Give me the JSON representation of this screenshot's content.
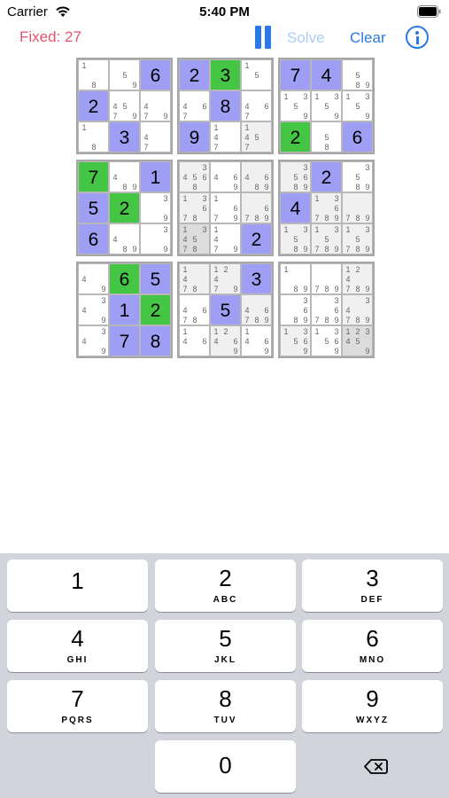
{
  "status_bar": {
    "carrier": "Carrier",
    "time": "5:40 PM"
  },
  "nav": {
    "fixed_label": "Fixed: 27",
    "solve_label": "Solve",
    "clear_label": "Clear"
  },
  "colors": {
    "blue_cell": "#9e9ef5",
    "green_cell": "#44c544",
    "accent": "#2a79e6",
    "fixed_text": "#e8526e"
  },
  "grid": [
    [
      {
        "n": [
          1,
          8
        ]
      },
      {
        "n": [
          5,
          9
        ]
      },
      {
        "v": "6",
        "c": "blue"
      },
      {
        "v": "2",
        "c": "blue"
      },
      {
        "v": "3",
        "c": "green"
      },
      {
        "n": [
          1,
          5
        ]
      },
      {
        "v": "7",
        "c": "blue"
      },
      {
        "v": "4",
        "c": "blue"
      },
      {
        "n": [
          5,
          8,
          9
        ]
      }
    ],
    [
      {
        "v": "2",
        "c": "blue"
      },
      {
        "n": [
          4,
          5,
          9,
          7
        ]
      },
      {
        "n": [
          4,
          7,
          9
        ]
      },
      {
        "n": [
          4,
          6,
          7
        ]
      },
      {
        "v": "8",
        "c": "blue"
      },
      {
        "n": [
          4,
          6,
          7
        ]
      },
      {
        "n": [
          1,
          3,
          5,
          9
        ]
      },
      {
        "n": [
          1,
          3,
          5,
          9
        ]
      },
      {
        "n": [
          1,
          3,
          5,
          9
        ]
      }
    ],
    [
      {
        "n": [
          1,
          8
        ]
      },
      {
        "v": "3",
        "c": "blue"
      },
      {
        "n": [
          4,
          7
        ]
      },
      {
        "v": "9",
        "c": "blue"
      },
      {
        "n": [
          1,
          4,
          7
        ]
      },
      {
        "n": [
          1,
          4,
          5,
          7
        ],
        "c": "lgray"
      },
      {
        "v": "2",
        "c": "green"
      },
      {
        "n": [
          5,
          8
        ]
      },
      {
        "v": "6",
        "c": "blue"
      }
    ],
    [
      {
        "v": "7",
        "c": "green"
      },
      {
        "n": [
          4,
          8,
          9
        ]
      },
      {
        "v": "1",
        "c": "blue"
      },
      {
        "n": [
          3,
          4,
          5,
          6,
          8
        ],
        "c": "lgray"
      },
      {
        "n": [
          4,
          6,
          9
        ]
      },
      {
        "n": [
          4,
          6,
          8,
          9
        ],
        "c": "lgray"
      },
      {
        "n": [
          3,
          5,
          6,
          8,
          9
        ],
        "c": "lgray"
      },
      {
        "v": "2",
        "c": "blue"
      },
      {
        "n": [
          3,
          5,
          8,
          9
        ]
      }
    ],
    [
      {
        "v": "5",
        "c": "blue"
      },
      {
        "v": "2",
        "c": "green"
      },
      {
        "n": [
          3,
          9
        ]
      },
      {
        "n": [
          1,
          3,
          6,
          7,
          8
        ],
        "c": "lgray"
      },
      {
        "n": [
          1,
          6,
          7,
          9
        ]
      },
      {
        "n": [
          6,
          7,
          8,
          9
        ],
        "c": "lgray"
      },
      {
        "v": "4",
        "c": "blue"
      },
      {
        "n": [
          1,
          3,
          6,
          7,
          8,
          9
        ],
        "c": "lgray"
      },
      {
        "n": [
          7,
          8,
          9
        ],
        "c": "lgray"
      }
    ],
    [
      {
        "v": "6",
        "c": "blue"
      },
      {
        "n": [
          4,
          8,
          9
        ]
      },
      {
        "n": [
          3,
          9
        ]
      },
      {
        "n": [
          1,
          3,
          4,
          5,
          7,
          8
        ],
        "c": "dgray"
      },
      {
        "n": [
          1,
          4,
          7,
          9
        ]
      },
      {
        "v": "2",
        "c": "blue"
      },
      {
        "n": [
          1,
          3,
          5,
          8,
          9
        ],
        "c": "lgray"
      },
      {
        "n": [
          1,
          3,
          5,
          7,
          8,
          9
        ],
        "c": "lgray"
      },
      {
        "n": [
          1,
          3,
          5,
          7,
          8,
          9
        ],
        "c": "lgray"
      }
    ],
    [
      {
        "n": [
          4,
          9
        ]
      },
      {
        "v": "6",
        "c": "green"
      },
      {
        "v": "5",
        "c": "blue"
      },
      {
        "n": [
          1,
          4,
          7,
          8
        ],
        "c": "lgray"
      },
      {
        "n": [
          1,
          2,
          4,
          7,
          9
        ],
        "c": "lgray"
      },
      {
        "v": "3",
        "c": "blue"
      },
      {
        "n": [
          1,
          8,
          9
        ]
      },
      {
        "n": [
          7,
          8,
          9
        ]
      },
      {
        "n": [
          1,
          2,
          4,
          7,
          8,
          9
        ],
        "c": "lgray"
      }
    ],
    [
      {
        "n": [
          3,
          4,
          9
        ]
      },
      {
        "v": "1",
        "c": "blue"
      },
      {
        "v": "2",
        "c": "green"
      },
      {
        "n": [
          4,
          6,
          7,
          8
        ]
      },
      {
        "v": "5",
        "c": "blue"
      },
      {
        "n": [
          4,
          6,
          7,
          8,
          9
        ],
        "c": "lgray"
      },
      {
        "n": [
          3,
          6,
          8,
          9
        ]
      },
      {
        "n": [
          3,
          6,
          7,
          8,
          9
        ]
      },
      {
        "n": [
          3,
          4,
          7,
          8,
          9
        ],
        "c": "lgray"
      }
    ],
    [
      {
        "n": [
          3,
          4,
          9
        ]
      },
      {
        "v": "7",
        "c": "blue"
      },
      {
        "v": "8",
        "c": "blue"
      },
      {
        "n": [
          1,
          4,
          6
        ]
      },
      {
        "n": [
          1,
          2,
          4,
          6,
          9
        ],
        "c": "lgray"
      },
      {
        "n": [
          1,
          4,
          6,
          9
        ]
      },
      {
        "n": [
          1,
          3,
          5,
          6,
          9
        ],
        "c": "lgray"
      },
      {
        "n": [
          1,
          3,
          5,
          6,
          9
        ]
      },
      {
        "n": [
          1,
          2,
          3,
          4,
          5,
          9
        ],
        "c": "dgray"
      }
    ]
  ],
  "keypad": [
    {
      "num": "1",
      "letters": ""
    },
    {
      "num": "2",
      "letters": "ABC"
    },
    {
      "num": "3",
      "letters": "DEF"
    },
    {
      "num": "4",
      "letters": "GHI"
    },
    {
      "num": "5",
      "letters": "JKL"
    },
    {
      "num": "6",
      "letters": "MNO"
    },
    {
      "num": "7",
      "letters": "PQRS"
    },
    {
      "num": "8",
      "letters": "TUV"
    },
    {
      "num": "9",
      "letters": "WXYZ"
    },
    {
      "num": "0",
      "letters": ""
    }
  ]
}
